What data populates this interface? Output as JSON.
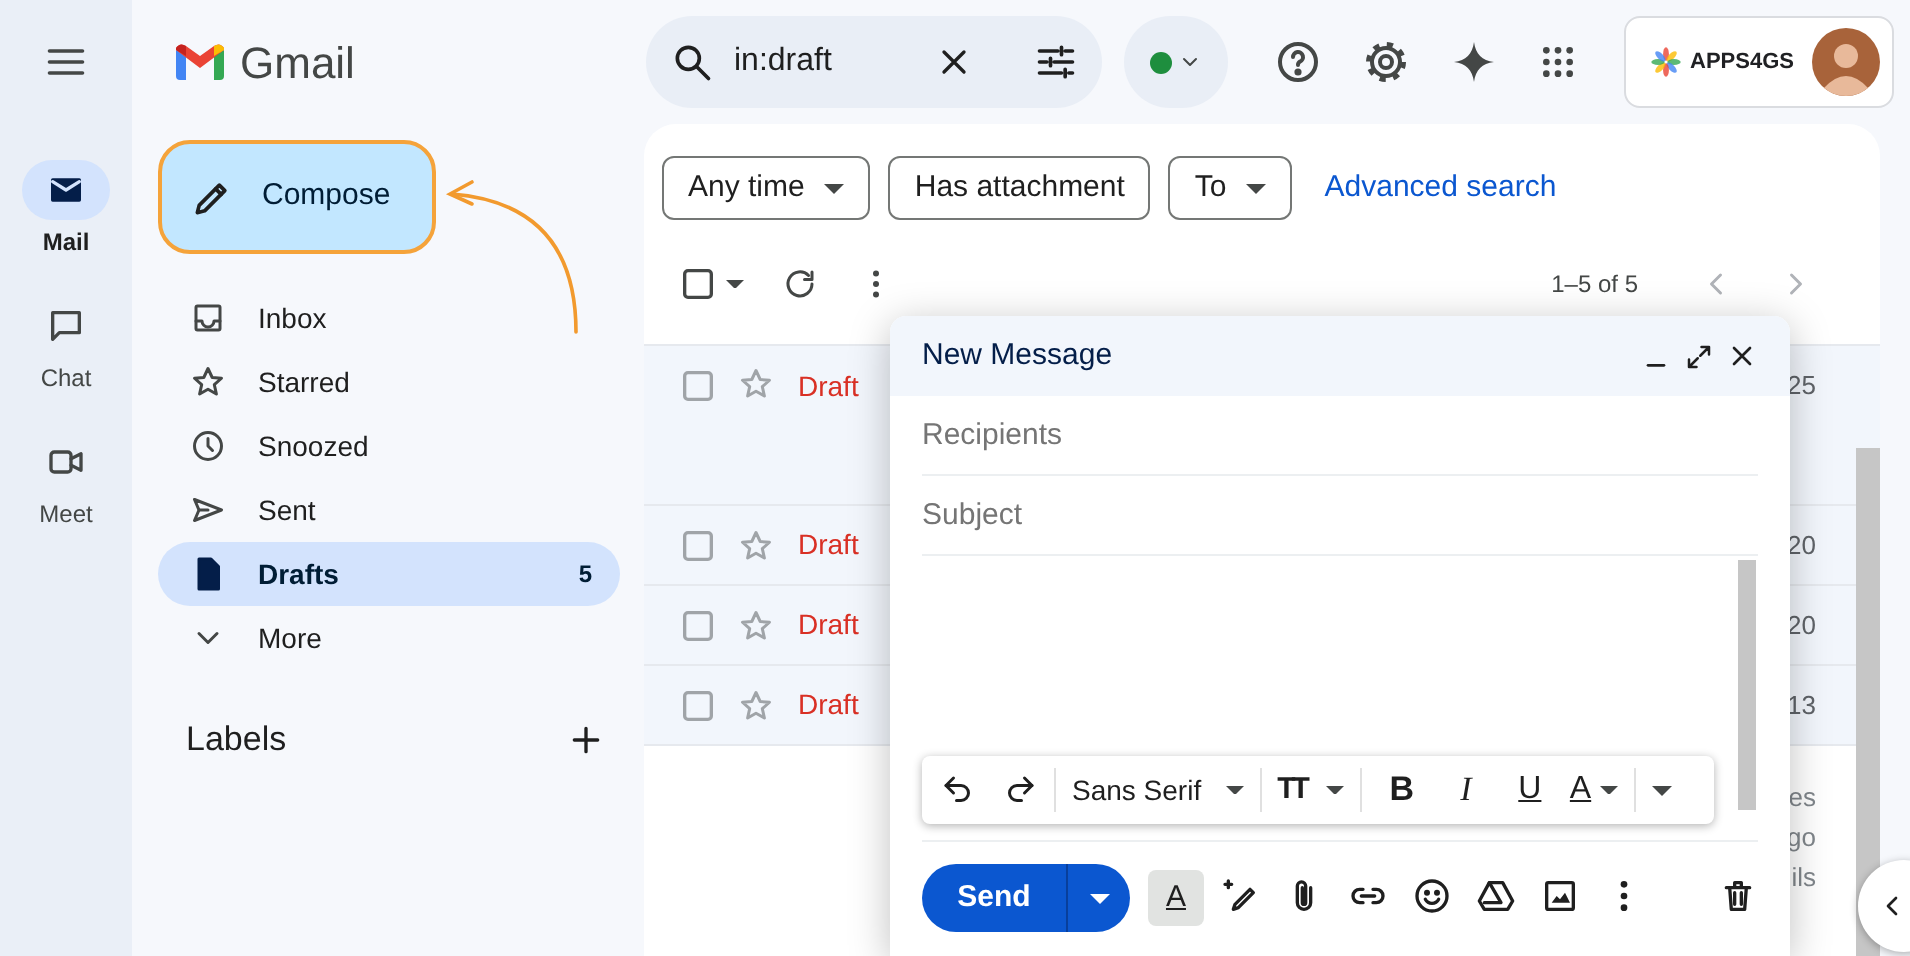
{
  "app_name": "Gmail",
  "rail": [
    {
      "kind": "mail",
      "label": "Mail",
      "selected": true
    },
    {
      "kind": "chat",
      "label": "Chat",
      "selected": false
    },
    {
      "kind": "meet",
      "label": "Meet",
      "selected": false
    }
  ],
  "search": {
    "value": "in:draft"
  },
  "account": {
    "brand": "APPS4GS"
  },
  "compose_button": {
    "label": "Compose"
  },
  "folders": [
    {
      "kind": "inbox",
      "label": "Inbox",
      "selected": false
    },
    {
      "kind": "starred",
      "label": "Starred",
      "selected": false
    },
    {
      "kind": "snoozed",
      "label": "Snoozed",
      "selected": false
    },
    {
      "kind": "sent",
      "label": "Sent",
      "selected": false
    },
    {
      "kind": "drafts",
      "label": "Drafts",
      "selected": true,
      "count": "5"
    },
    {
      "kind": "more",
      "label": "More",
      "selected": false
    }
  ],
  "labels_heading": "Labels",
  "filters": [
    {
      "label": "Any time",
      "has_menu": true
    },
    {
      "label": "Has attachment",
      "has_menu": false
    },
    {
      "label": "To",
      "has_menu": true
    }
  ],
  "advanced_search": "Advanced search",
  "pagination": "1–5 of 5",
  "messages": [
    {
      "label": "Draft",
      "date": "25",
      "checked": false,
      "starred": false,
      "tall": true
    },
    {
      "label": "Draft",
      "date": "20",
      "checked": false,
      "starred": false,
      "tall": false
    },
    {
      "label": "Draft",
      "date": "20",
      "checked": false,
      "starred": false,
      "tall": false
    },
    {
      "label": "Draft",
      "date": "13",
      "checked": false,
      "starred": false,
      "tall": false
    }
  ],
  "cut_lines": [
    "es",
    "go",
    "ils"
  ],
  "compose": {
    "title": "New Message",
    "recipients_placeholder": "Recipients",
    "subject_placeholder": "Subject",
    "format_toolbar": {
      "font": "Sans Serif",
      "size_glyph": "TT",
      "bold": "B",
      "italic": "I",
      "underline": "U",
      "text_color_glyph": "A"
    },
    "send": "Send",
    "formatting_toggle": {
      "glyph": "A",
      "on": true
    }
  }
}
